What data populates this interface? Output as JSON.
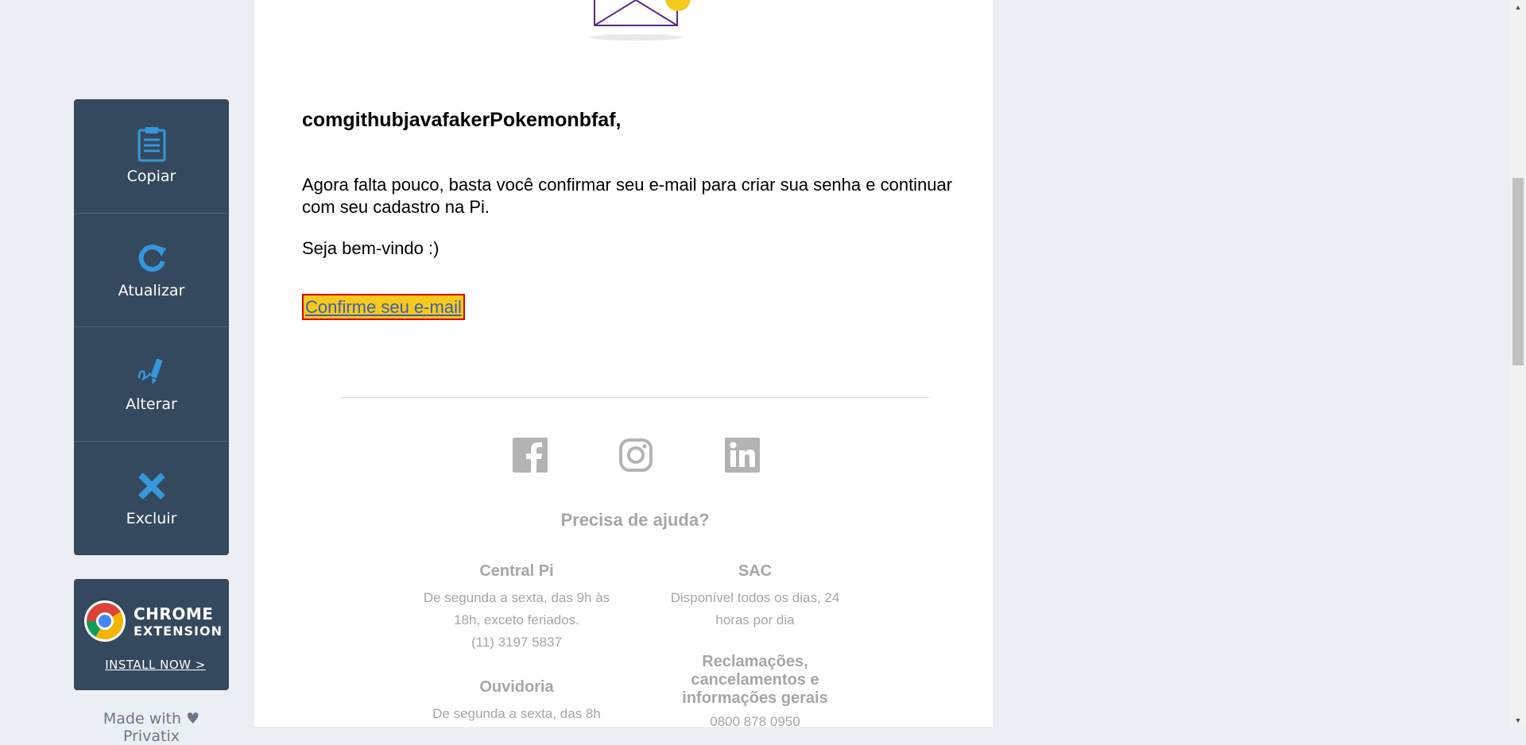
{
  "sidebar": {
    "items": [
      {
        "label": "Copiar",
        "icon": "clipboard-icon"
      },
      {
        "label": "Atualizar",
        "icon": "refresh-icon"
      },
      {
        "label": "Alterar",
        "icon": "edit-signature-icon"
      },
      {
        "label": "Excluir",
        "icon": "close-x-icon"
      }
    ],
    "chrome_extension": {
      "title": "CHROME",
      "subtitle": "EXTENSION",
      "install_label": "INSTALL NOW >"
    },
    "made_with": "Made with ♥ Privatix"
  },
  "email": {
    "greeting": "comgithubjavafakerPokemonbfaf,",
    "body": "Agora falta pouco, basta você confirmar seu e-mail para criar sua senha e continuar com seu cadastro na Pi.",
    "welcome": "Seja bem-vindo :)",
    "confirm_link": "Confirme seu e-mail",
    "help_title": "Precisa de ajuda?",
    "contacts": {
      "central": {
        "title": "Central Pi",
        "text": "De segunda a sexta, das 9h às 18h, exceto feriados.",
        "phone": "(11) 3197 5837"
      },
      "sac": {
        "title": "SAC",
        "text": "Disponível todos os dias, 24 horas por dia"
      },
      "ouvidoria": {
        "title": "Ouvidoria",
        "text": "De segunda a sexta, das 8h"
      },
      "reclamacoes": {
        "title": "Reclamações, cancelamentos e informações gerais",
        "phone": "0800 878 0950"
      }
    }
  },
  "colors": {
    "sidebar_bg": "#34495e",
    "accent_blue": "#3498db",
    "link_highlight": "#f7c91a",
    "link_border": "#e00000",
    "muted_text": "#a6a6a6"
  }
}
